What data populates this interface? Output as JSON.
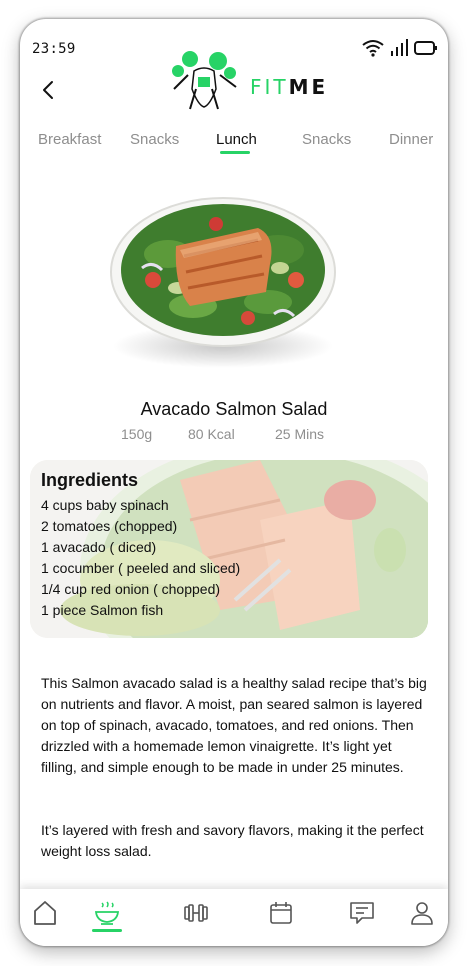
{
  "status_bar": {
    "time": "23:59"
  },
  "brand": {
    "fit": "FIT",
    "me": "ME"
  },
  "tabs": [
    {
      "label": "Breakfast",
      "active": false
    },
    {
      "label": "Snacks",
      "active": false
    },
    {
      "label": "Lunch",
      "active": true
    },
    {
      "label": "Snacks",
      "active": false
    },
    {
      "label": "Dinner",
      "active": false
    }
  ],
  "recipe": {
    "title": "Avacado Salmon Salad",
    "weight": "150g",
    "calories": "80 Kcal",
    "time": "25 Mins"
  },
  "ingredients": {
    "title": "Ingredients",
    "items": [
      "4 cups baby spinach",
      "2 tomatoes (chopped)",
      "1 avacado ( diced)",
      "1 cocumber ( peeled and sliced)",
      "1/4 cup red onion ( chopped)",
      "1 piece Salmon fish"
    ]
  },
  "description": {
    "p1": "This Salmon avacado salad is a healthy salad recipe that’s big on nutrients and flavor. A moist, pan seared salmon is layered on top of spinach, avacado, tomatoes, and red onions. Then drizzled with a homemade lemon vinaigrette. It’s light yet filling, and simple enough to be made in under 25 minutes.",
    "p2": "It’s layered with fresh and savory flavors, making it the perfect weight loss salad."
  },
  "colors": {
    "accent": "#27d366",
    "muted": "#8e8e8e",
    "text": "#111111"
  },
  "nav": [
    "home-icon",
    "bowl-icon",
    "dumbbell-icon",
    "calendar-icon",
    "chat-icon",
    "profile-icon"
  ]
}
